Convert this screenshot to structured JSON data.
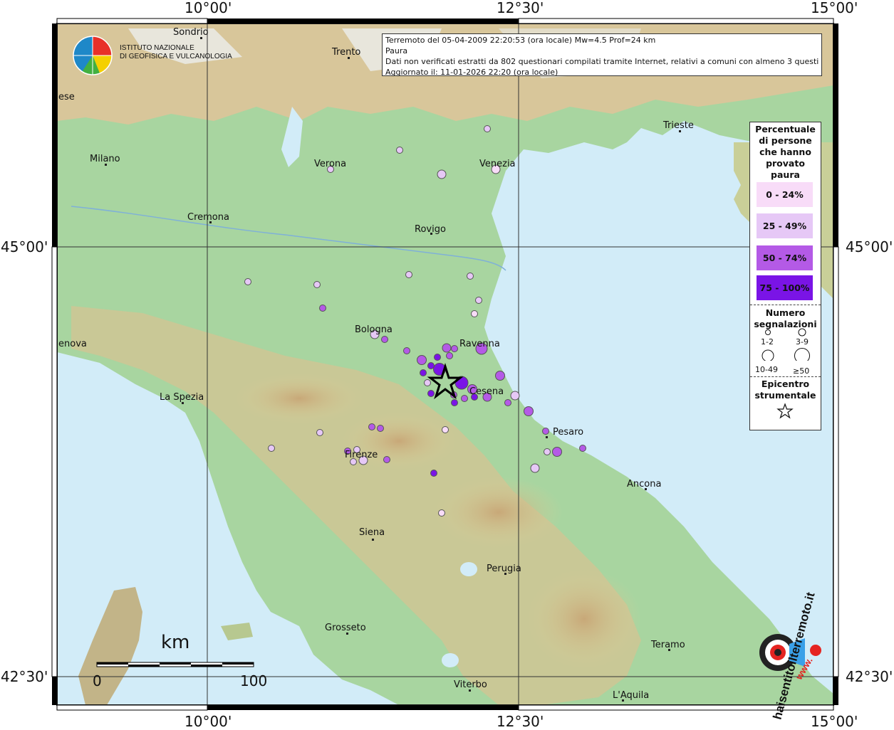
{
  "grid_labels": {
    "top": [
      "10°00'",
      "12°30'",
      "15°00'"
    ],
    "bottom": [
      "10°00'",
      "12°30'",
      "15°00'"
    ],
    "left": [
      "45°00'",
      "42°30'"
    ],
    "right": [
      "45°00'",
      "42°30'"
    ]
  },
  "logo": {
    "line1": "ISTITUTO NAZIONALE",
    "line2": "DI GEOFISICA E VULCANOLOGIA"
  },
  "info": {
    "line1": "Terremoto del 05-04-2009 22:20:53 (ora locale) Mw=4.5 Prof=24 km",
    "line2": "Paura",
    "line3": "Dati non verificati estratti da 802 questionari compilati tramite Internet, relativi a comuni con almeno 3 questionari.",
    "line4": "Aggiornato il: 11-01-2026 22:20 (ora locale)"
  },
  "legend": {
    "title": "Percentuale di persone che hanno provato paura",
    "classes": [
      {
        "label": "0 - 24%",
        "color": "#f8dcf8"
      },
      {
        "label": "25 - 49%",
        "color": "#e6c8f6"
      },
      {
        "label": "50 - 74%",
        "color": "#b45ae6"
      },
      {
        "label": "75 - 100%",
        "color": "#7a14e6"
      }
    ],
    "size_title": "Numero segnalazioni",
    "sizes": [
      "1-2",
      "3-9",
      "10-49",
      "≥50"
    ],
    "epi_title": "Epicentro strumentale"
  },
  "cities": [
    {
      "name": "Sondrio"
    },
    {
      "name": "Trento"
    },
    {
      "name": "Trieste"
    },
    {
      "name": "Milano"
    },
    {
      "name": "Verona"
    },
    {
      "name": "Venezia"
    },
    {
      "name": "Cremona"
    },
    {
      "name": "Rovigo"
    },
    {
      "name": "Bologna"
    },
    {
      "name": "Ravenna"
    },
    {
      "name": "enova"
    },
    {
      "name": "ese"
    },
    {
      "name": "La Spezia"
    },
    {
      "name": "Cesena"
    },
    {
      "name": "Pesaro"
    },
    {
      "name": "Firenze"
    },
    {
      "name": "Ancona"
    },
    {
      "name": "Siena"
    },
    {
      "name": "Perugia"
    },
    {
      "name": "Grosseto"
    },
    {
      "name": "Teramo"
    },
    {
      "name": "Viterbo"
    },
    {
      "name": "L'Aquila"
    }
  ],
  "scale": {
    "unit": "km",
    "start": "0",
    "end": "100"
  },
  "brand": {
    "text": "haisentitoilterremoto.it",
    "www": "www."
  },
  "colors": {
    "sea": "#d2ecf8",
    "lowland": "#a8d5a0",
    "hill": "#d8cc98",
    "mountain": "#c4a47a",
    "alpine": "#e8e8e0"
  }
}
